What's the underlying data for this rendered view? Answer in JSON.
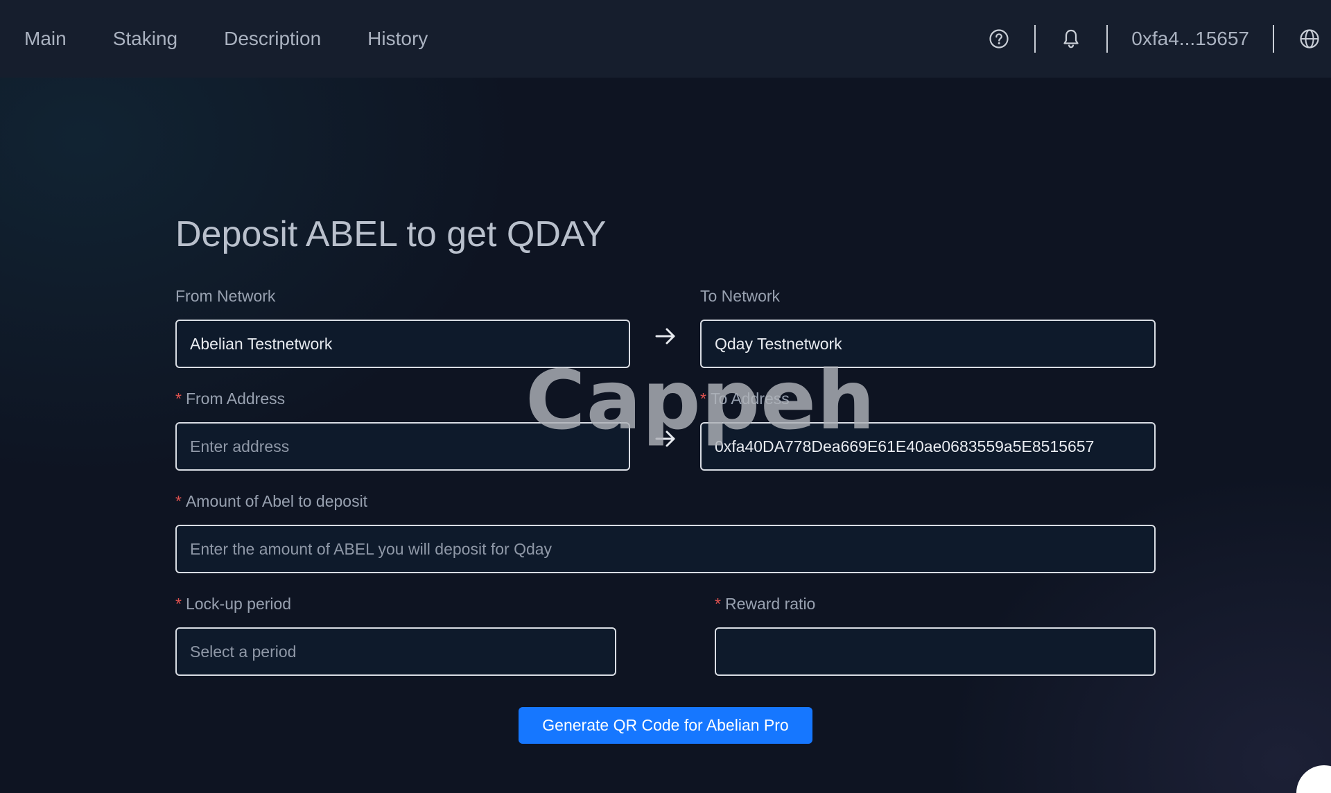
{
  "nav": {
    "items": [
      {
        "label": "Main"
      },
      {
        "label": "Staking"
      },
      {
        "label": "Description"
      },
      {
        "label": "History"
      }
    ]
  },
  "header": {
    "account": "0xfa4...15657",
    "icons": [
      "help-circle-icon",
      "bell-icon",
      "globe-icon"
    ]
  },
  "form": {
    "title": "Deposit ABEL to get QDAY",
    "from_network": {
      "label": "From Network",
      "value": "Abelian Testnetwork"
    },
    "to_network": {
      "label": "To Network",
      "value": "Qday Testnetwork"
    },
    "from_address": {
      "label": "From Address",
      "required": "*",
      "placeholder": "Enter address",
      "value": ""
    },
    "to_address": {
      "label": "To Address",
      "required": "*",
      "value": "0xfa40DA778Dea669E61E40ae0683559a5E8515657"
    },
    "amount": {
      "label": "Amount of Abel to deposit",
      "required": "*",
      "placeholder": "Enter the amount of ABEL you will deposit for Qday",
      "value": ""
    },
    "lockup": {
      "label": "Lock-up period",
      "required": "*",
      "placeholder": "Select a period"
    },
    "reward_ratio": {
      "label": "Reward ratio",
      "required": "*",
      "value": ""
    },
    "submit_label": "Generate QR Code for Abelian Pro"
  },
  "watermark": "Cappeh",
  "colors": {
    "accent": "#1677ff",
    "required": "#e0524f",
    "topbar": "#161e2d",
    "background": "#0e1422"
  }
}
